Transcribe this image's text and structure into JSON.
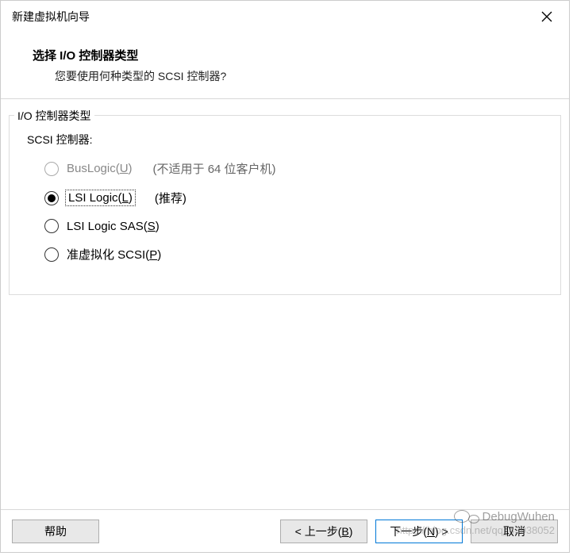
{
  "titlebar": {
    "title": "新建虚拟机向导"
  },
  "header": {
    "title": "选择 I/O 控制器类型",
    "subtitle": "您要使用何种类型的 SCSI 控制器?"
  },
  "groupbox": {
    "label": "I/O 控制器类型"
  },
  "scsi": {
    "label": "SCSI 控制器:"
  },
  "options": {
    "buslogic": {
      "label_pre": "BusLogic(",
      "label_u": "U",
      "label_post": ")",
      "hint": "(不适用于 64 位客户机)"
    },
    "lsilogic": {
      "label_pre": "LSI Logic(",
      "label_u": "L",
      "label_post": ")",
      "hint": "(推荐)"
    },
    "lsisas": {
      "label_pre": "LSI Logic SAS(",
      "label_u": "S",
      "label_post": ")"
    },
    "pvscsi": {
      "label_pre": "准虚拟化 SCSI(",
      "label_u": "P",
      "label_post": ")"
    }
  },
  "footer": {
    "help": "帮助",
    "back_pre": "< 上一步(",
    "back_u": "B",
    "back_post": ")",
    "next_pre": "下一步(",
    "next_u": "N",
    "next_post": ") >",
    "cancel": "取消"
  },
  "watermark": {
    "name": "DebugWuhen",
    "url": "https://blog.csdn.net/qq_43938052"
  }
}
